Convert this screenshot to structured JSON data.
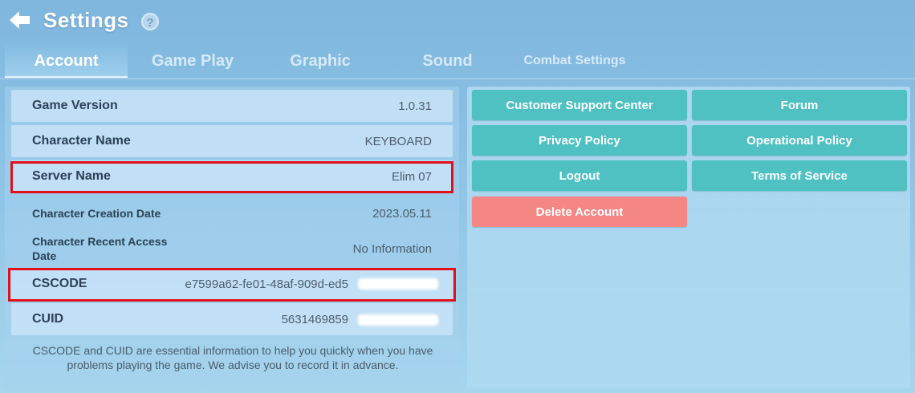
{
  "header": {
    "title": "Settings",
    "help_symbol": "?"
  },
  "tabs": [
    {
      "label": "Account",
      "active": true
    },
    {
      "label": "Game Play",
      "active": false
    },
    {
      "label": "Graphic",
      "active": false
    },
    {
      "label": "Sound",
      "active": false
    },
    {
      "label": "Combat Settings",
      "active": false
    }
  ],
  "account": {
    "rows": [
      {
        "label": "Game Version",
        "value": "1.0.31"
      },
      {
        "label": "Character Name",
        "value": "KEYBOARD"
      },
      {
        "label": "Server Name",
        "value": "Elim 07"
      },
      {
        "label": "Character Creation Date",
        "value": "2023.05.11"
      },
      {
        "label": "Character Recent Access Date",
        "value": "No Information"
      },
      {
        "label": "CSCODE",
        "value": "e7599a62-fe01-48af-909d-ed5"
      },
      {
        "label": "CUID",
        "value": "5631469859"
      }
    ],
    "note": "CSCODE and CUID are essential information to help you quickly when you have problems playing the game. We advise you to record it in advance."
  },
  "buttons": {
    "customer_support": "Customer Support Center",
    "forum": "Forum",
    "privacy_policy": "Privacy Policy",
    "operational_policy": "Operational Policy",
    "logout": "Logout",
    "terms_of_service": "Terms of Service",
    "delete_account": "Delete Account"
  },
  "colors": {
    "button": "#4fc1c2",
    "danger_button": "#f48784",
    "highlight": "#e2101a"
  }
}
